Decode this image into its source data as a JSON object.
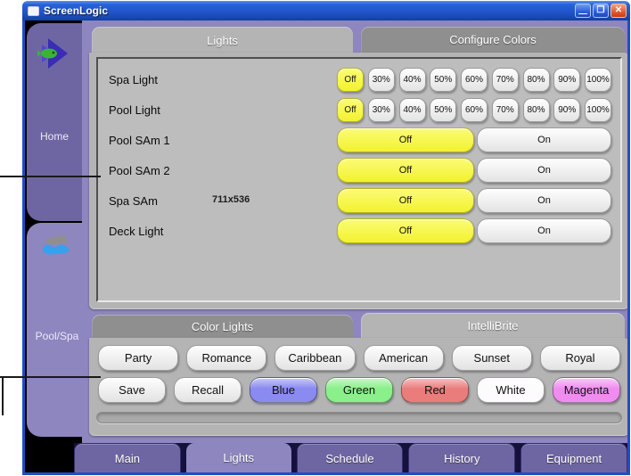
{
  "window": {
    "title": "ScreenLogic",
    "size_overlay": "711x536",
    "controls": [
      {
        "name": "minimize",
        "glyph": "—"
      },
      {
        "name": "maximize",
        "glyph": "❐"
      },
      {
        "name": "close",
        "glyph": "✕"
      }
    ]
  },
  "sidebar": {
    "items": [
      {
        "label": "Home",
        "icon": "screenlogic-logo-icon",
        "active": false
      },
      {
        "label": "Pool/Spa",
        "icon": "swimmer-icon",
        "active": true
      }
    ]
  },
  "lights_section": {
    "tabs": [
      {
        "label": "Lights",
        "active": true
      },
      {
        "label": "Configure Colors",
        "active": false
      }
    ],
    "rows": [
      {
        "label": "Spa Light",
        "style": "dimmer",
        "buttons": [
          "Off",
          "30%",
          "40%",
          "50%",
          "60%",
          "70%",
          "80%",
          "90%",
          "100%"
        ],
        "active": "Off"
      },
      {
        "label": "Pool Light",
        "style": "dimmer",
        "buttons": [
          "Off",
          "30%",
          "40%",
          "50%",
          "60%",
          "70%",
          "80%",
          "90%",
          "100%"
        ],
        "active": "Off"
      },
      {
        "label": "Pool SAm 1",
        "style": "toggle",
        "buttons": [
          "Off",
          "On"
        ],
        "active": "Off"
      },
      {
        "label": "Pool SAm 2",
        "style": "toggle",
        "buttons": [
          "Off",
          "On"
        ],
        "active": "Off"
      },
      {
        "label": "Spa SAm",
        "style": "toggle",
        "buttons": [
          "Off",
          "On"
        ],
        "active": "Off"
      },
      {
        "label": "Deck Light",
        "style": "toggle",
        "buttons": [
          "Off",
          "On"
        ],
        "active": "Off"
      }
    ]
  },
  "color_section": {
    "tabs": [
      {
        "label": "Color Lights",
        "active": false
      },
      {
        "label": "IntelliBrite",
        "active": true
      }
    ],
    "show_buttons": [
      "Party",
      "Romance",
      "Caribbean",
      "American",
      "Sunset",
      "Royal"
    ],
    "color_buttons": [
      {
        "label": "Save",
        "color": ""
      },
      {
        "label": "Recall",
        "color": ""
      },
      {
        "label": "Blue",
        "color": "#8a8af0"
      },
      {
        "label": "Green",
        "color": "#8af08a"
      },
      {
        "label": "Red",
        "color": "#ea7c7c"
      },
      {
        "label": "White",
        "color": "#fdfbfd"
      },
      {
        "label": "Magenta",
        "color": "#f08cf0"
      }
    ]
  },
  "bottom_tabs": [
    {
      "label": "Main",
      "active": false
    },
    {
      "label": "Lights",
      "active": true
    },
    {
      "label": "Schedule",
      "active": false
    },
    {
      "label": "History",
      "active": false
    },
    {
      "label": "Equipment",
      "active": false
    }
  ],
  "colors": {
    "titlebar_blue": "#2a62d8",
    "window_border": "#1f4ec4",
    "client_purple": "#8d86bf",
    "tab_purple_dark": "#6e66a2",
    "panel_gray": "#b4b4b4",
    "inactive_tab_gray": "#8f8f8f",
    "active_yellow": "#f6f644"
  }
}
